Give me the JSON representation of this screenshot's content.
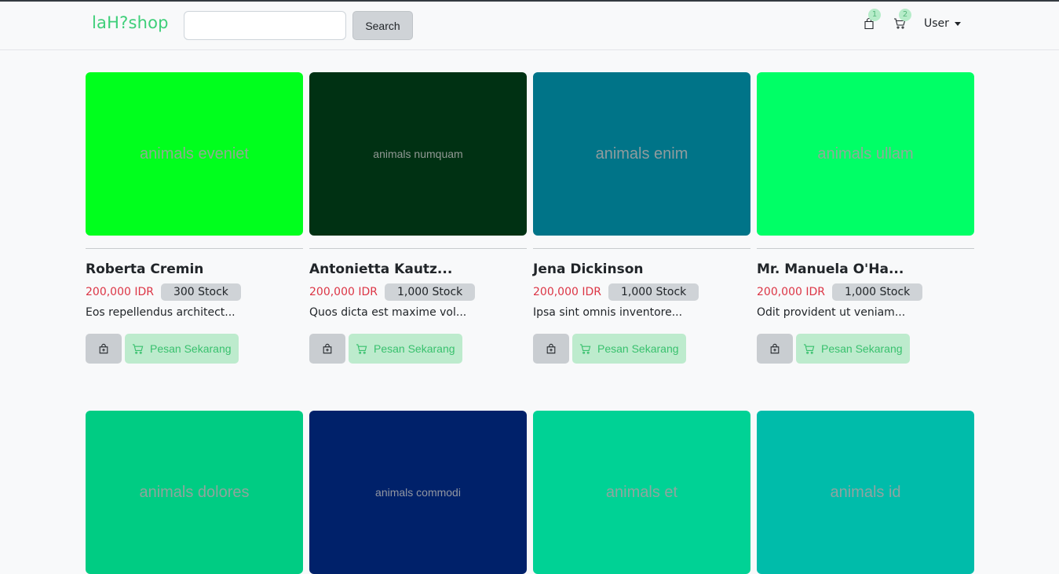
{
  "navbar": {
    "brand": "laH?shop",
    "search_placeholder": "",
    "search_label": "Search",
    "bag_count": "1",
    "cart_count": "2",
    "user_label": "User",
    "icons": [
      "shopping-bag-icon",
      "cart-icon",
      "caret-down-icon"
    ]
  },
  "colors": {
    "brand": "#3ecf79",
    "price": "#dc3545",
    "order_bg": "#bdebcd",
    "order_text": "#39c16e"
  },
  "products": [
    {
      "image_text": "animals eveniet",
      "image_color": "#00ff1d",
      "name": "Roberta Cremin",
      "price": "200,000 IDR",
      "stock": "300 Stock",
      "desc": "Eos repellendus architect...",
      "bag_icon": "bag-plus-icon",
      "order_label": "Pesan Sekarang"
    },
    {
      "image_text": "animals numquam",
      "image_color": "#003113",
      "name": "Antonietta Kautz...",
      "price": "200,000 IDR",
      "stock": "1,000 Stock",
      "desc": "Quos dicta est maxime vol...",
      "bag_icon": "bag-plus-icon",
      "order_label": "Pesan Sekarang"
    },
    {
      "image_text": "animals enim",
      "image_color": "#007488",
      "name": "Jena Dickinson",
      "price": "200,000 IDR",
      "stock": "1,000 Stock",
      "desc": "Ipsa sint omnis inventore...",
      "bag_icon": "bag-plus-icon",
      "order_label": "Pesan Sekarang"
    },
    {
      "image_text": "animals ullam",
      "image_color": "#00ff66",
      "name": "Mr. Manuela O'Ha...",
      "price": "200,000 IDR",
      "stock": "1,000 Stock",
      "desc": "Odit provident ut veniam...",
      "bag_icon": "bag-plus-icon",
      "order_label": "Pesan Sekarang"
    },
    {
      "image_text": "animals dolores",
      "image_color": "#00cc83",
      "name": "",
      "price": "",
      "stock": "",
      "desc": "",
      "bag_icon": "bag-plus-icon",
      "order_label": ""
    },
    {
      "image_text": "animals commodi",
      "image_color": "#00216a",
      "name": "",
      "price": "",
      "stock": "",
      "desc": "",
      "bag_icon": "bag-plus-icon",
      "order_label": ""
    },
    {
      "image_text": "animals et",
      "image_color": "#00d295",
      "name": "",
      "price": "",
      "stock": "",
      "desc": "",
      "bag_icon": "bag-plus-icon",
      "order_label": ""
    },
    {
      "image_text": "animals id",
      "image_color": "#00bcaa",
      "name": "",
      "price": "",
      "stock": "",
      "desc": "",
      "bag_icon": "bag-plus-icon",
      "order_label": ""
    }
  ]
}
